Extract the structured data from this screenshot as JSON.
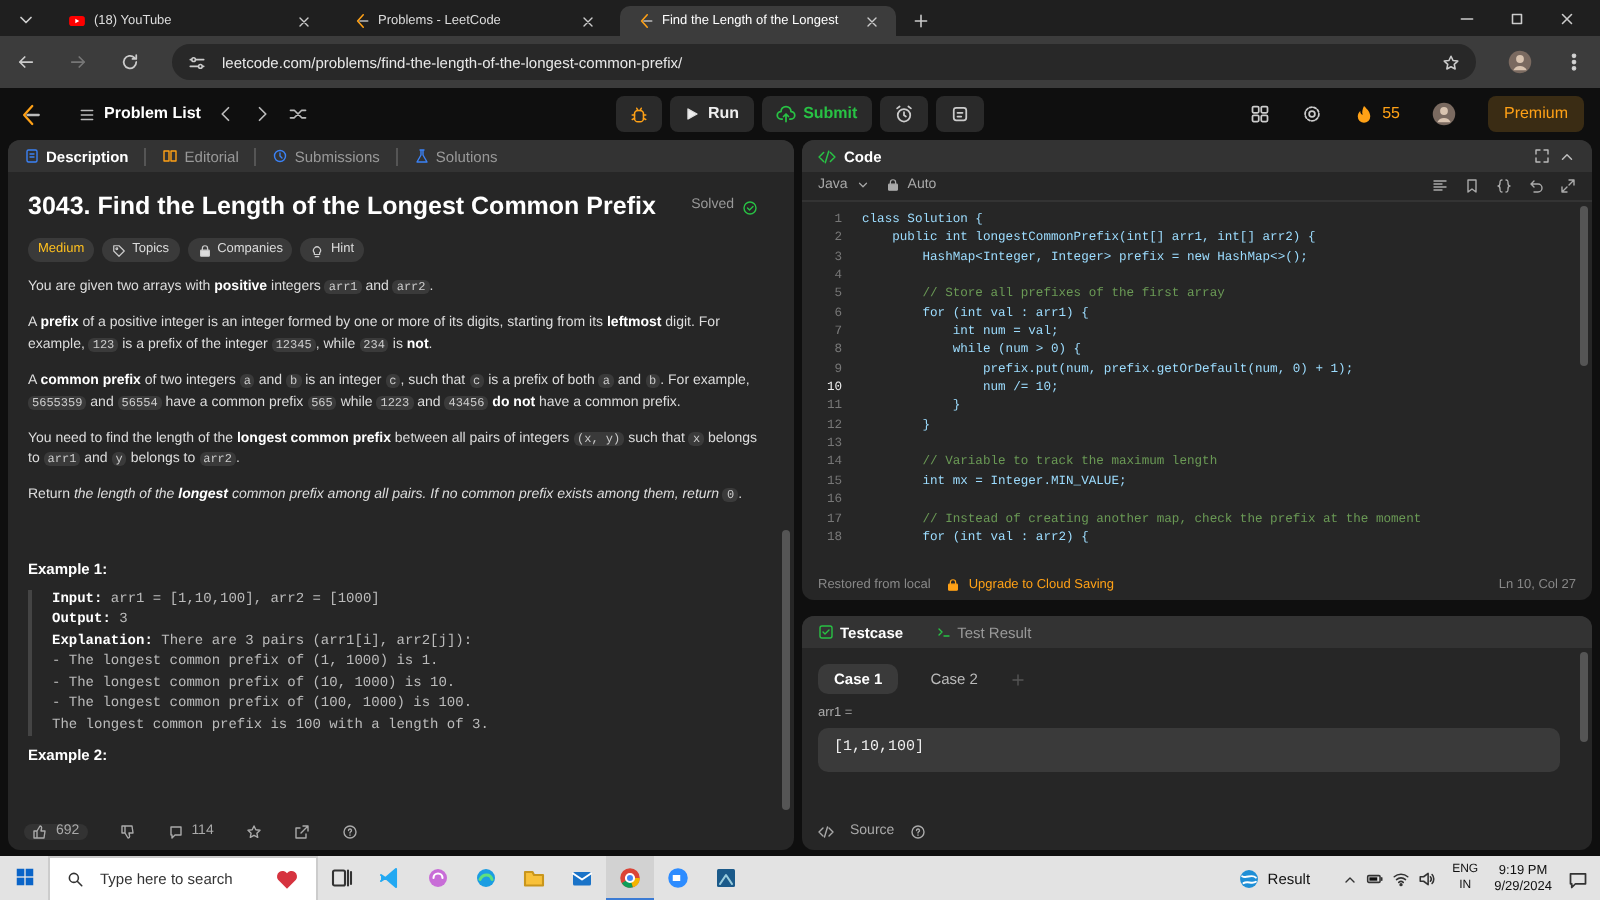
{
  "browser": {
    "tabs": [
      {
        "title": "(18) YouTube",
        "kind": "youtube",
        "selected": false
      },
      {
        "title": "Problems - LeetCode",
        "kind": "leetcode",
        "selected": false
      },
      {
        "title": "Find the Length of the Longest",
        "kind": "leetcode",
        "selected": true
      }
    ],
    "url": "leetcode.com/problems/find-the-length-of-the-longest-common-prefix/"
  },
  "header": {
    "problem_list": "Problem List",
    "run": "Run",
    "submit": "Submit",
    "streak": "55",
    "premium": "Premium"
  },
  "description": {
    "tabs": [
      {
        "label": "Description",
        "kind": "description",
        "selected": true
      },
      {
        "label": "Editorial",
        "kind": "editorial",
        "selected": false
      },
      {
        "label": "Submissions",
        "kind": "submissions",
        "selected": false
      },
      {
        "label": "Solutions",
        "kind": "solutions",
        "selected": false
      }
    ],
    "title": "3043. Find the Length of the Longest Common Prefix",
    "status": "Solved",
    "tags": [
      {
        "label": "Medium",
        "kind": "difficulty"
      },
      {
        "label": "Topics",
        "kind": "topics"
      },
      {
        "label": "Companies",
        "kind": "companies"
      },
      {
        "label": "Hint",
        "kind": "hint"
      }
    ],
    "paragraphs": [
      [
        {
          "text": "You are given two arrays with ",
          "kind": "text"
        },
        {
          "text": "positive",
          "kind": "bold"
        },
        {
          "text": " integers ",
          "kind": "text"
        },
        {
          "text": "arr1",
          "kind": "code"
        },
        {
          "text": " and ",
          "kind": "text"
        },
        {
          "text": "arr2",
          "kind": "code"
        },
        {
          "text": ".",
          "kind": "text"
        }
      ],
      [
        {
          "text": "A ",
          "kind": "text"
        },
        {
          "text": "prefix",
          "kind": "bold"
        },
        {
          "text": " of a positive integer is an integer formed by one or more of its digits, starting from its ",
          "kind": "text"
        },
        {
          "text": "leftmost",
          "kind": "bold"
        },
        {
          "text": " digit. For example, ",
          "kind": "text"
        },
        {
          "text": "123",
          "kind": "code"
        },
        {
          "text": " is a prefix of the integer ",
          "kind": "text"
        },
        {
          "text": "12345",
          "kind": "code"
        },
        {
          "text": ", while ",
          "kind": "text"
        },
        {
          "text": "234",
          "kind": "code"
        },
        {
          "text": " is ",
          "kind": "text"
        },
        {
          "text": "not",
          "kind": "bold"
        },
        {
          "text": ".",
          "kind": "text"
        }
      ],
      [
        {
          "text": "A ",
          "kind": "text"
        },
        {
          "text": "common prefix",
          "kind": "bold"
        },
        {
          "text": " of two integers ",
          "kind": "text"
        },
        {
          "text": "a",
          "kind": "code"
        },
        {
          "text": " and ",
          "kind": "text"
        },
        {
          "text": "b",
          "kind": "code"
        },
        {
          "text": " is an integer ",
          "kind": "text"
        },
        {
          "text": "c",
          "kind": "code"
        },
        {
          "text": ", such that ",
          "kind": "text"
        },
        {
          "text": "c",
          "kind": "code"
        },
        {
          "text": " is a prefix of both ",
          "kind": "text"
        },
        {
          "text": "a",
          "kind": "code"
        },
        {
          "text": " and ",
          "kind": "text"
        },
        {
          "text": "b",
          "kind": "code"
        },
        {
          "text": ". For example, ",
          "kind": "text"
        },
        {
          "text": "5655359",
          "kind": "code"
        },
        {
          "text": " and ",
          "kind": "text"
        },
        {
          "text": "56554",
          "kind": "code"
        },
        {
          "text": " have a common prefix ",
          "kind": "text"
        },
        {
          "text": "565",
          "kind": "code"
        },
        {
          "text": " while ",
          "kind": "text"
        },
        {
          "text": "1223",
          "kind": "code"
        },
        {
          "text": " and ",
          "kind": "text"
        },
        {
          "text": "43456",
          "kind": "code"
        },
        {
          "text": " do not",
          "kind": "bold"
        },
        {
          "text": " have a common prefix.",
          "kind": "text"
        }
      ],
      [
        {
          "text": "You need to find the length of the ",
          "kind": "text"
        },
        {
          "text": "longest common prefix",
          "kind": "bold"
        },
        {
          "text": " between all pairs of integers ",
          "kind": "text"
        },
        {
          "text": "(x, y)",
          "kind": "code"
        },
        {
          "text": " such that ",
          "kind": "text"
        },
        {
          "text": "x",
          "kind": "code"
        },
        {
          "text": " belongs to ",
          "kind": "text"
        },
        {
          "text": "arr1",
          "kind": "code"
        },
        {
          "text": " and ",
          "kind": "text"
        },
        {
          "text": "y",
          "kind": "code"
        },
        {
          "text": " belongs to ",
          "kind": "text"
        },
        {
          "text": "arr2",
          "kind": "code"
        },
        {
          "text": ".",
          "kind": "text"
        }
      ],
      [
        {
          "text": "Return ",
          "kind": "text"
        },
        {
          "text": "the length of the ",
          "kind": "italic"
        },
        {
          "text": "longest",
          "kind": "bold-italic"
        },
        {
          "text": " common prefix among all pairs. If no common prefix exists among them, return ",
          "kind": "italic"
        },
        {
          "text": "0",
          "kind": "code"
        },
        {
          "text": ".",
          "kind": "text"
        }
      ]
    ],
    "examples": [
      {
        "heading": "Example 1:",
        "lines": [
          "**Input:** arr1 = [1,10,100], arr2 = [1000]",
          "**Output:** 3",
          "**Explanation:** There are 3 pairs (arr1[i], arr2[j]):",
          "- The longest common prefix of (1, 1000) is 1.",
          "- The longest common prefix of (10, 1000) is 10.",
          "- The longest common prefix of (100, 1000) is 100.",
          "The longest common prefix is 100 with a length of 3."
        ]
      },
      {
        "heading": "Example 2:"
      }
    ],
    "likes": "692",
    "comments": "114"
  },
  "code": {
    "title": "Code",
    "language": "Java",
    "mode": "Auto",
    "lines": [
      {
        "number": "1",
        "text": "class Solution {",
        "kind": "code",
        "current": false
      },
      {
        "number": "2",
        "text": "    public int longestCommonPrefix(int[] arr1, int[] arr2) {",
        "kind": "code",
        "current": false
      },
      {
        "number": "3",
        "text": "        HashMap<Integer, Integer> prefix = new HashMap<>();",
        "kind": "code",
        "current": false
      },
      {
        "number": "4",
        "kind": "blank",
        "current": false
      },
      {
        "number": "5",
        "text": "        // Store all prefixes of the first array",
        "kind": "comment",
        "current": false
      },
      {
        "number": "6",
        "text": "        for (int val : arr1) {",
        "kind": "code",
        "current": false
      },
      {
        "number": "7",
        "text": "            int num = val;",
        "kind": "code",
        "current": false
      },
      {
        "number": "8",
        "text": "            while (num > 0) {",
        "kind": "code",
        "current": false
      },
      {
        "number": "9",
        "text": "                prefix.put(num, prefix.getOrDefault(num, 0) + 1);",
        "kind": "code",
        "current": false
      },
      {
        "number": "10",
        "text": "                num /= 10;",
        "kind": "code",
        "current": true
      },
      {
        "number": "11",
        "text": "            }",
        "kind": "code",
        "current": false
      },
      {
        "number": "12",
        "text": "        }",
        "kind": "code",
        "current": false
      },
      {
        "number": "13",
        "kind": "blank",
        "current": false
      },
      {
        "number": "14",
        "text": "        // Variable to track the maximum length",
        "kind": "comment",
        "current": false
      },
      {
        "number": "15",
        "text": "        int mx = Integer.MIN_VALUE;",
        "kind": "code",
        "current": false
      },
      {
        "number": "16",
        "kind": "blank",
        "current": false
      },
      {
        "number": "17",
        "text": "        // Instead of creating another map, check the prefix at the moment",
        "kind": "comment",
        "current": false
      },
      {
        "number": "18",
        "text": "        for (int val : arr2) {",
        "kind": "code",
        "current": false
      }
    ],
    "saved": "Restored from local",
    "upgrade": "Upgrade to Cloud Saving",
    "cursor": "Ln 10, Col 27"
  },
  "testcase": {
    "tabs": [
      {
        "label": "Testcase",
        "kind": "testcase",
        "selected": true
      },
      {
        "label": "Test Result",
        "kind": "result",
        "selected": false
      }
    ],
    "cases": [
      {
        "label": "Case 1",
        "selected": true
      },
      {
        "label": "Case 2",
        "selected": false
      }
    ],
    "inputs": [
      {
        "label": "arr1 =",
        "value": "[1,10,100]"
      }
    ],
    "source": "Source"
  },
  "taskbar": {
    "search_placeholder": "Type here to search",
    "apps": [
      {
        "kind": "taskview",
        "active": false
      },
      {
        "kind": "vscode",
        "active": false
      },
      {
        "kind": "copilot",
        "active": false
      },
      {
        "kind": "edge",
        "active": false
      },
      {
        "kind": "folder",
        "active": false
      },
      {
        "kind": "mail",
        "active": false
      },
      {
        "kind": "chrome",
        "active": true
      },
      {
        "kind": "zoom",
        "active": false
      },
      {
        "kind": "paint",
        "active": false
      }
    ],
    "weather": "Result",
    "language": "ENG",
    "region": "IN",
    "time": "9:19 PM",
    "date": "9/29/2024"
  }
}
